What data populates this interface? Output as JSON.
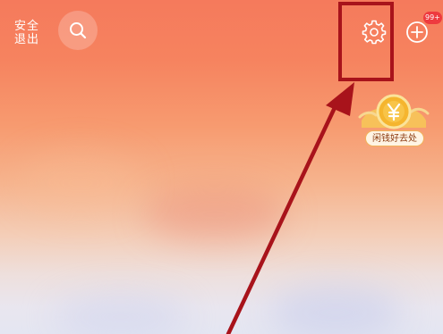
{
  "header": {
    "safe_exit_line1": "安全",
    "safe_exit_line2": "退出",
    "search_icon": "search-icon",
    "settings_icon": "gear-icon",
    "add_icon": "plus-circle-icon",
    "notification_badge": "99+"
  },
  "promo": {
    "icon": "yuan-coin-icon",
    "label": "闲钱好去处"
  },
  "annotation": {
    "highlight_color": "#a8131b",
    "arrow_color": "#a8131b"
  },
  "colors": {
    "background_top": "#f57a5c",
    "background_bottom": "#e4e6f2",
    "badge": "#ee3a3f",
    "coin_gold": "#f5b52e"
  }
}
